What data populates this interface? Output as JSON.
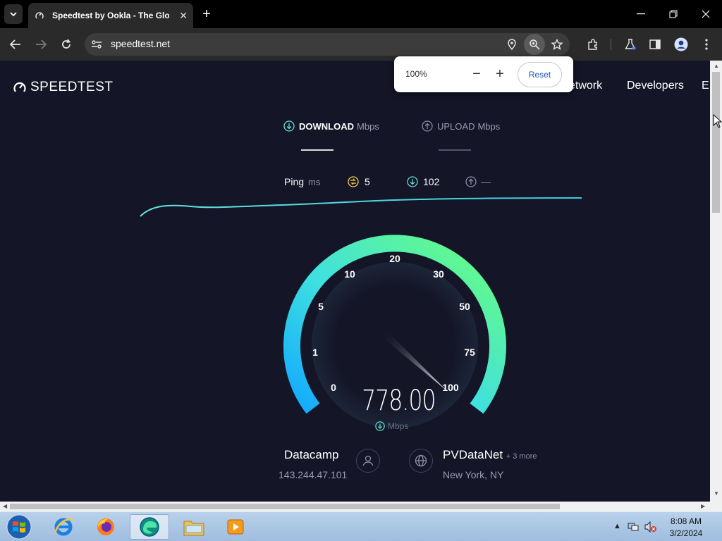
{
  "browser": {
    "tab_title": "Speedtest by Ookla - The Glob",
    "url": "speedtest.net"
  },
  "zoom_popup": {
    "percent": "100%",
    "reset_label": "Reset"
  },
  "site": {
    "logo": "SPEEDTEST",
    "nav": [
      "etwork",
      "Developers",
      "E"
    ]
  },
  "test": {
    "download_label": "DOWNLOAD",
    "download_unit": "Mbps",
    "upload_label": "UPLOAD",
    "upload_unit": "Mbps",
    "ping_label": "Ping",
    "ping_unit": "ms",
    "ping_value": "5",
    "download_ping": "102",
    "upload_ping": "—",
    "gauge_ticks": [
      "0",
      "1",
      "5",
      "10",
      "20",
      "30",
      "50",
      "75",
      "100"
    ],
    "speed_value": "778.00",
    "speed_unit": "Mbps"
  },
  "host": {
    "name": "Datacamp",
    "ip": "143.244.47.101"
  },
  "server": {
    "name": "PVDataNet",
    "more": "+ 3 more",
    "location": "New York, NY"
  },
  "taskbar": {
    "time": "8:08 AM",
    "date": "3/2/2024"
  },
  "colors": {
    "page_bg": "#141526",
    "gauge_start": "#1fb7ff",
    "gauge_end": "#62ff8a"
  }
}
